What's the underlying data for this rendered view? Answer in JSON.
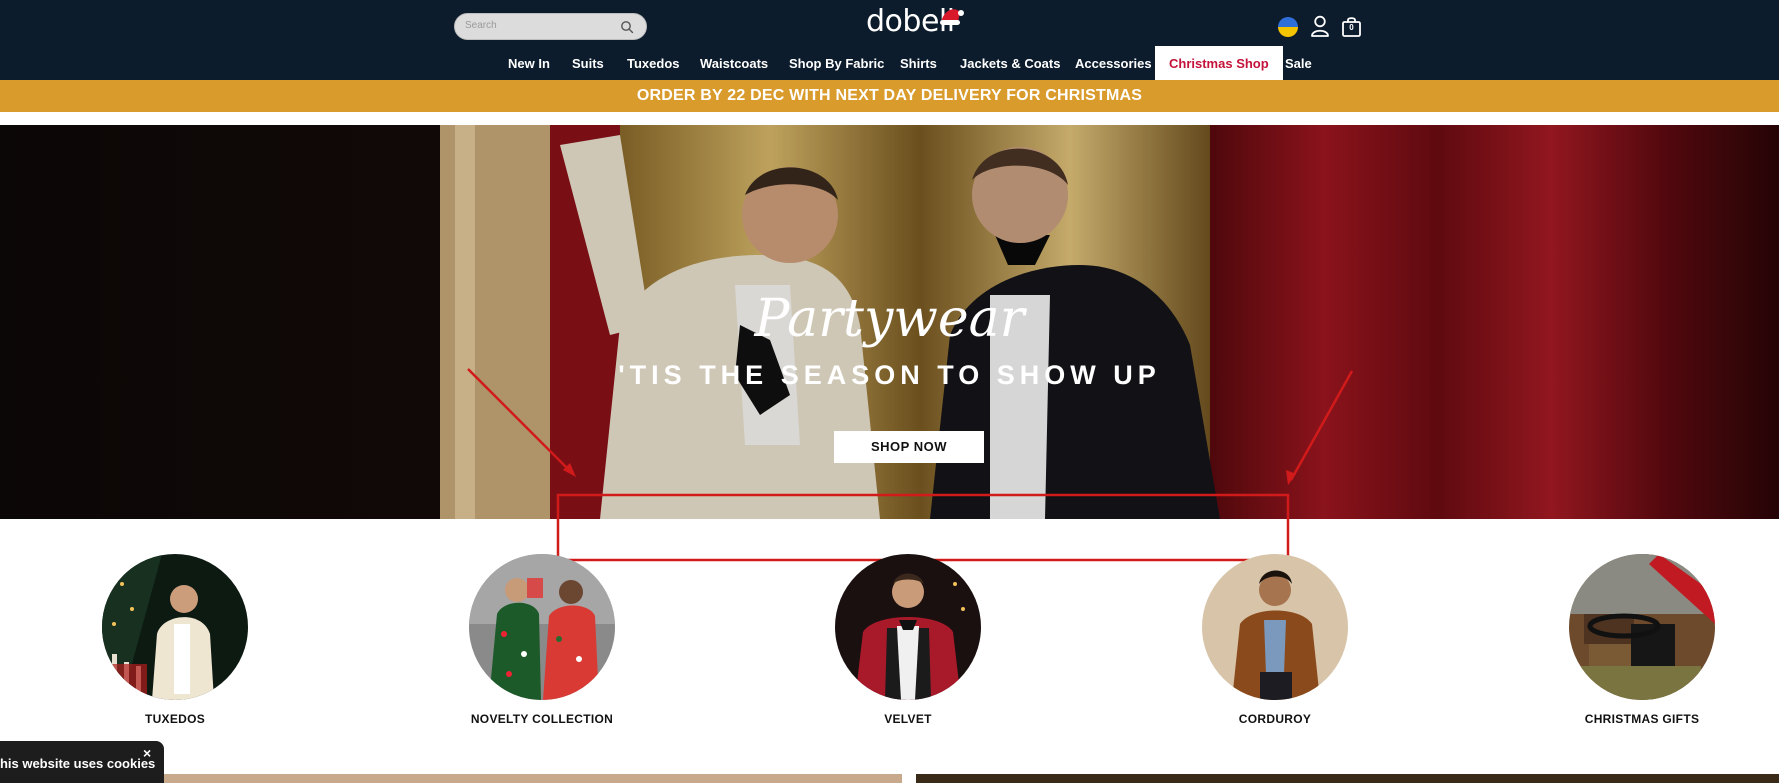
{
  "header": {
    "search_placeholder": "Search",
    "logo": "dobell",
    "bag_count": "0"
  },
  "nav": {
    "items": [
      "New In",
      "Suits",
      "Tuxedos",
      "Waistcoats",
      "Shop By Fabric",
      "Shirts",
      "Jackets & Coats",
      "Accessories",
      "Christmas Shop",
      "Sale"
    ],
    "active": "Christmas Shop"
  },
  "promo": {
    "text": "ORDER BY 22 DEC WITH NEXT DAY DELIVERY FOR CHRISTMAS"
  },
  "hero": {
    "title": "Partywear",
    "subtitle": "'TIS THE SEASON TO SHOW UP",
    "cta": "SHOP NOW"
  },
  "categories": [
    {
      "label": "TUXEDOS"
    },
    {
      "label": "NOVELTY COLLECTION"
    },
    {
      "label": "VELVET"
    },
    {
      "label": "CORDUROY"
    },
    {
      "label": "CHRISTMAS GIFTS"
    }
  ],
  "cookie": {
    "text": "This website uses cookies",
    "close": "×"
  },
  "colors": {
    "header_bg": "#0c1c2c",
    "promo_bg": "#d99b2b",
    "accent_red": "#c4123a",
    "annotation_red": "#d11a1a"
  }
}
